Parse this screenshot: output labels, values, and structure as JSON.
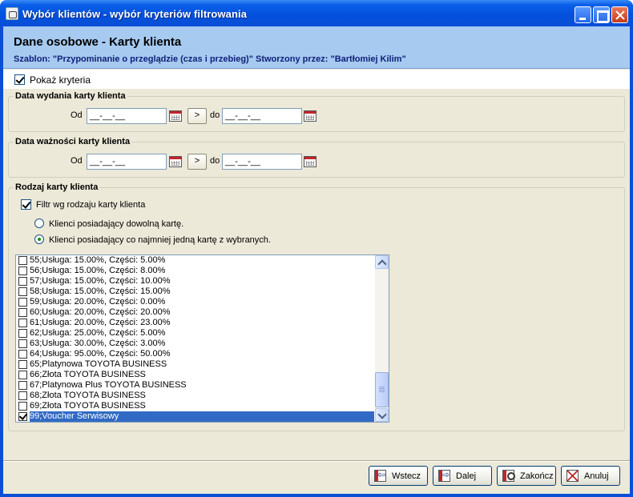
{
  "window": {
    "title": "Wybór klientów - wybór kryteriów filtrowania"
  },
  "header": {
    "title": "Dane osobowe - Karty klienta",
    "subtitle": "Szablon: \"Przypominanie o przeglądzie (czas i przebieg)\" Stworzony przez: \"Bartłomiej Kilim\""
  },
  "show_criteria": {
    "label": "Pokaż kryteria",
    "checked": true
  },
  "issue_date_group": {
    "title": "Data wydania karty klienta",
    "from_label": "Od",
    "from_value": "__-__-__",
    "arrow_label": ">",
    "to_label": "do",
    "to_value": "__-__-__"
  },
  "valid_date_group": {
    "title": "Data ważności karty klienta",
    "from_label": "Od",
    "from_value": "__-__-__",
    "arrow_label": ">",
    "to_label": "do",
    "to_value": "__-__-__"
  },
  "card_type_group": {
    "title": "Rodzaj karty klienta",
    "filter_label": "Filtr wg rodzaju karty klienta",
    "filter_checked": true,
    "option_any": "Klienci posiadający dowolną kartę.",
    "option_selected": "Klienci posiadający co najmniej jedną kartę z wybranych.",
    "selected_option": "option_selected"
  },
  "card_list": {
    "items": [
      {
        "label": "55;Usługa: 15.00%, Części:  5.00%",
        "checked": false,
        "selected": false
      },
      {
        "label": "56;Usługa: 15.00%, Części:  8.00%",
        "checked": false,
        "selected": false
      },
      {
        "label": "57;Usługa: 15.00%, Części: 10.00%",
        "checked": false,
        "selected": false
      },
      {
        "label": "58;Usługa: 15.00%, Części: 15.00%",
        "checked": false,
        "selected": false
      },
      {
        "label": "59;Usługa: 20.00%, Części:  0.00%",
        "checked": false,
        "selected": false
      },
      {
        "label": "60;Usługa: 20.00%, Części: 20.00%",
        "checked": false,
        "selected": false
      },
      {
        "label": "61;Usługa: 20.00%, Części: 23.00%",
        "checked": false,
        "selected": false
      },
      {
        "label": "62;Usługa: 25.00%, Części:  5.00%",
        "checked": false,
        "selected": false
      },
      {
        "label": "63;Usługa: 30.00%, Części:  3.00%",
        "checked": false,
        "selected": false
      },
      {
        "label": "64;Usługa: 95.00%, Części: 50.00%",
        "checked": false,
        "selected": false
      },
      {
        "label": "65;Platynowa TOYOTA BUSINESS",
        "checked": false,
        "selected": false
      },
      {
        "label": "66;Złota TOYOTA BUSINESS",
        "checked": false,
        "selected": false
      },
      {
        "label": "67;Platynowa Plus TOYOTA BUSINESS",
        "checked": false,
        "selected": false
      },
      {
        "label": "68;Złota TOYOTA BUSINESS",
        "checked": false,
        "selected": false
      },
      {
        "label": "69;Złota TOYOTA BUSINESS",
        "checked": false,
        "selected": false
      },
      {
        "label": "99;Voucher Serwisowy",
        "checked": true,
        "selected": true
      }
    ]
  },
  "buttons": {
    "back": "Wstecz",
    "next": "Dalej",
    "finish": "Zakończ",
    "cancel": "Anuluj"
  }
}
